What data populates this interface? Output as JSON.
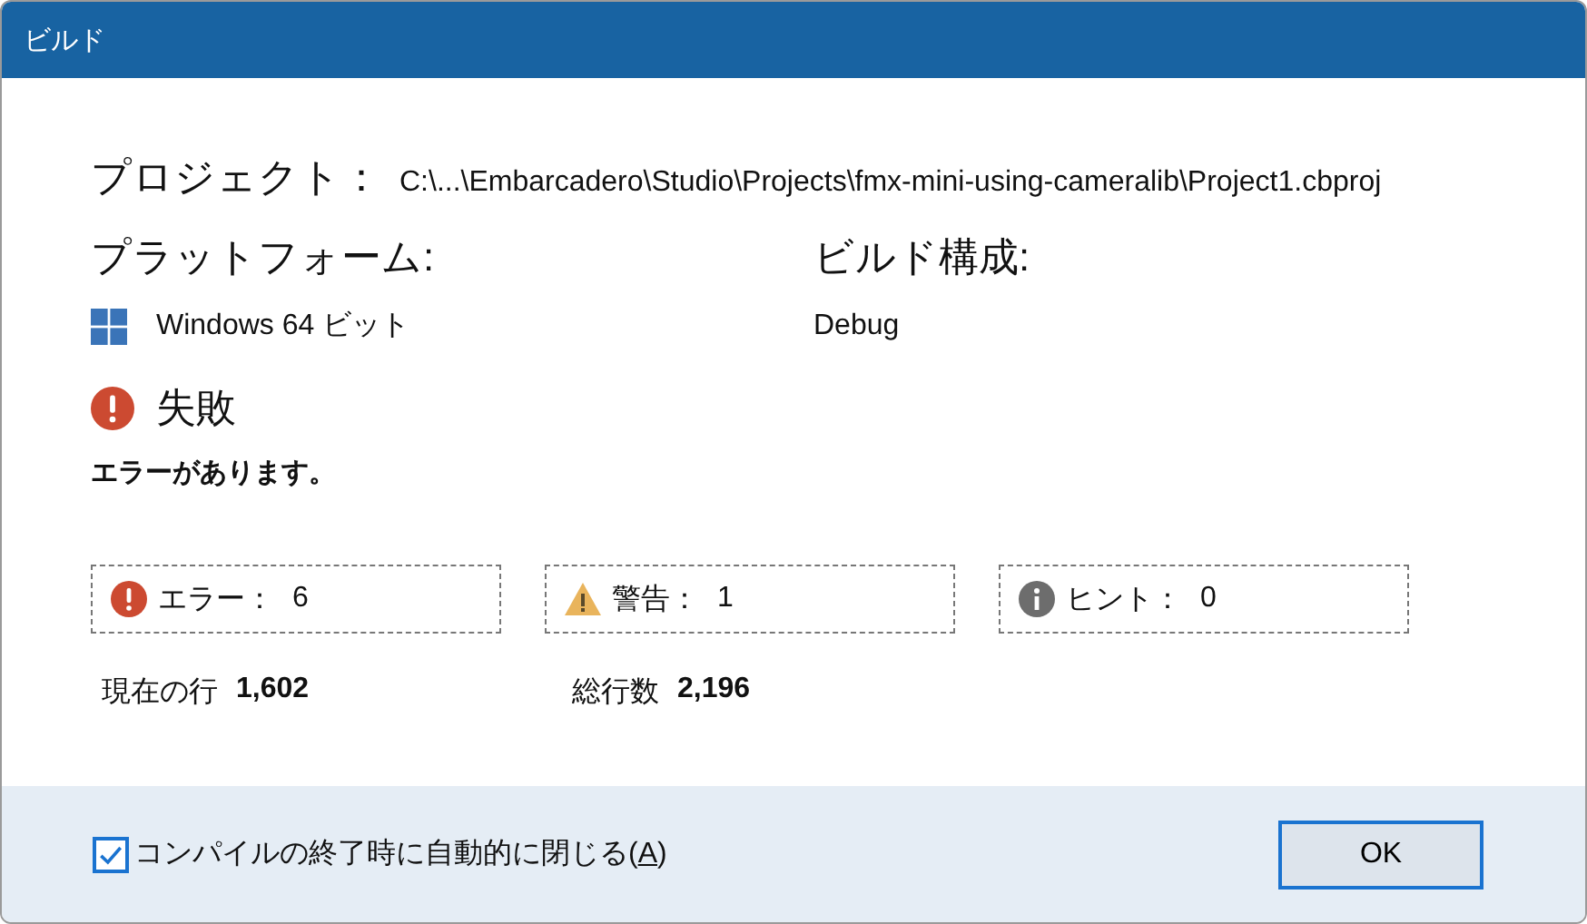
{
  "window": {
    "title": "ビルド"
  },
  "project": {
    "label": "プロジェクト：",
    "path": "C:\\...\\Embarcadero\\Studio\\Projects\\fmx-mini-using-cameralib\\Project1.cbproj"
  },
  "platform": {
    "label": "プラットフォーム:",
    "value": "Windows 64 ビット"
  },
  "configuration": {
    "label": "ビルド構成:",
    "value": "Debug"
  },
  "result": {
    "kind": "error",
    "title": "失敗",
    "message": "エラーがあります。"
  },
  "counters": [
    {
      "kind": "error",
      "label": "エラー：",
      "count": "6"
    },
    {
      "kind": "warning",
      "label": "警告：",
      "count": "1"
    },
    {
      "kind": "hint",
      "label": "ヒント：",
      "count": "0"
    }
  ],
  "lines": [
    {
      "label": "現在の行",
      "value": "1,602"
    },
    {
      "label": "総行数",
      "value": "2,196"
    }
  ],
  "footer": {
    "checkbox": {
      "checked": true,
      "label": "コンパイルの終了時に自動的に閉じる(",
      "mnemonic": "A",
      "label_end": ")"
    },
    "button": "OK"
  }
}
